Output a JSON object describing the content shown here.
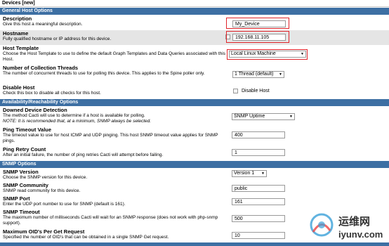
{
  "header": {
    "title": "Devices [new]"
  },
  "sections": {
    "general": "General Host Options",
    "availability": "Availability/Reachability Options",
    "snmp": "SNMP Options"
  },
  "fields": {
    "description": {
      "label": "Description",
      "desc": "Give this host a meaningful description.",
      "value": "My_Device"
    },
    "hostname": {
      "label": "Hostname",
      "desc": "Fully qualified hostname or IP address for this device.",
      "value": "192.168.11.105"
    },
    "host_template": {
      "label": "Host Template",
      "desc": "Choose the Host Template to use to define the default Graph Templates and Data Queries associated with this Host.",
      "value": "Local Linux Machine"
    },
    "threads": {
      "label": "Number of Collection Threads",
      "desc": "The number of concurrent threads to use for polling this device. This applies to the Spine poller only.",
      "value": "1 Thread (default)"
    },
    "disable_host": {
      "label": "Disable Host",
      "desc": "Check this box to disable all checks for this host.",
      "checkbox_label": "Disable Host"
    },
    "downed_device": {
      "label": "Downed Device Detection",
      "desc": "The method Cacti will use to determine if a host is available for polling.",
      "note": "NOTE: It is recommended that, at a minimum, SNMP always be selected.",
      "value": "SNMP Uptime"
    },
    "ping_timeout": {
      "label": "Ping Timeout Value",
      "desc": "The timeout value to use for host ICMP and UDP pinging. This host SNMP timeout value applies for SNMP pings.",
      "value": "400"
    },
    "ping_retry": {
      "label": "Ping Retry Count",
      "desc": "After an initial failure, the number of ping retries Cacti will attempt before failing.",
      "value": "1"
    },
    "snmp_version": {
      "label": "SNMP Version",
      "desc": "Choose the SNMP version for this device.",
      "value": "Version 1"
    },
    "snmp_community": {
      "label": "SNMP Community",
      "desc": "SNMP read community for this device.",
      "value": "public"
    },
    "snmp_port": {
      "label": "SNMP Port",
      "desc": "Enter the UDP port number to use for SNMP (default is 161).",
      "value": "161"
    },
    "snmp_timeout": {
      "label": "SNMP Timeout",
      "desc": "The maximum number of milliseconds Cacti will wait for an SNMP response (does not work with php-snmp support).",
      "value": "500"
    },
    "max_oids": {
      "label": "Maximum OID's Per Get Request",
      "desc": "Specified the number of OID's that can be obtained in a single SNMP Get request.",
      "value": "10"
    }
  },
  "watermark": {
    "cn": "运维网",
    "en": "iyunv.com"
  },
  "colors": {
    "section_bg": "#3d6fa3",
    "alt_row": "#e5e5e5",
    "highlight": "#e0242a"
  }
}
